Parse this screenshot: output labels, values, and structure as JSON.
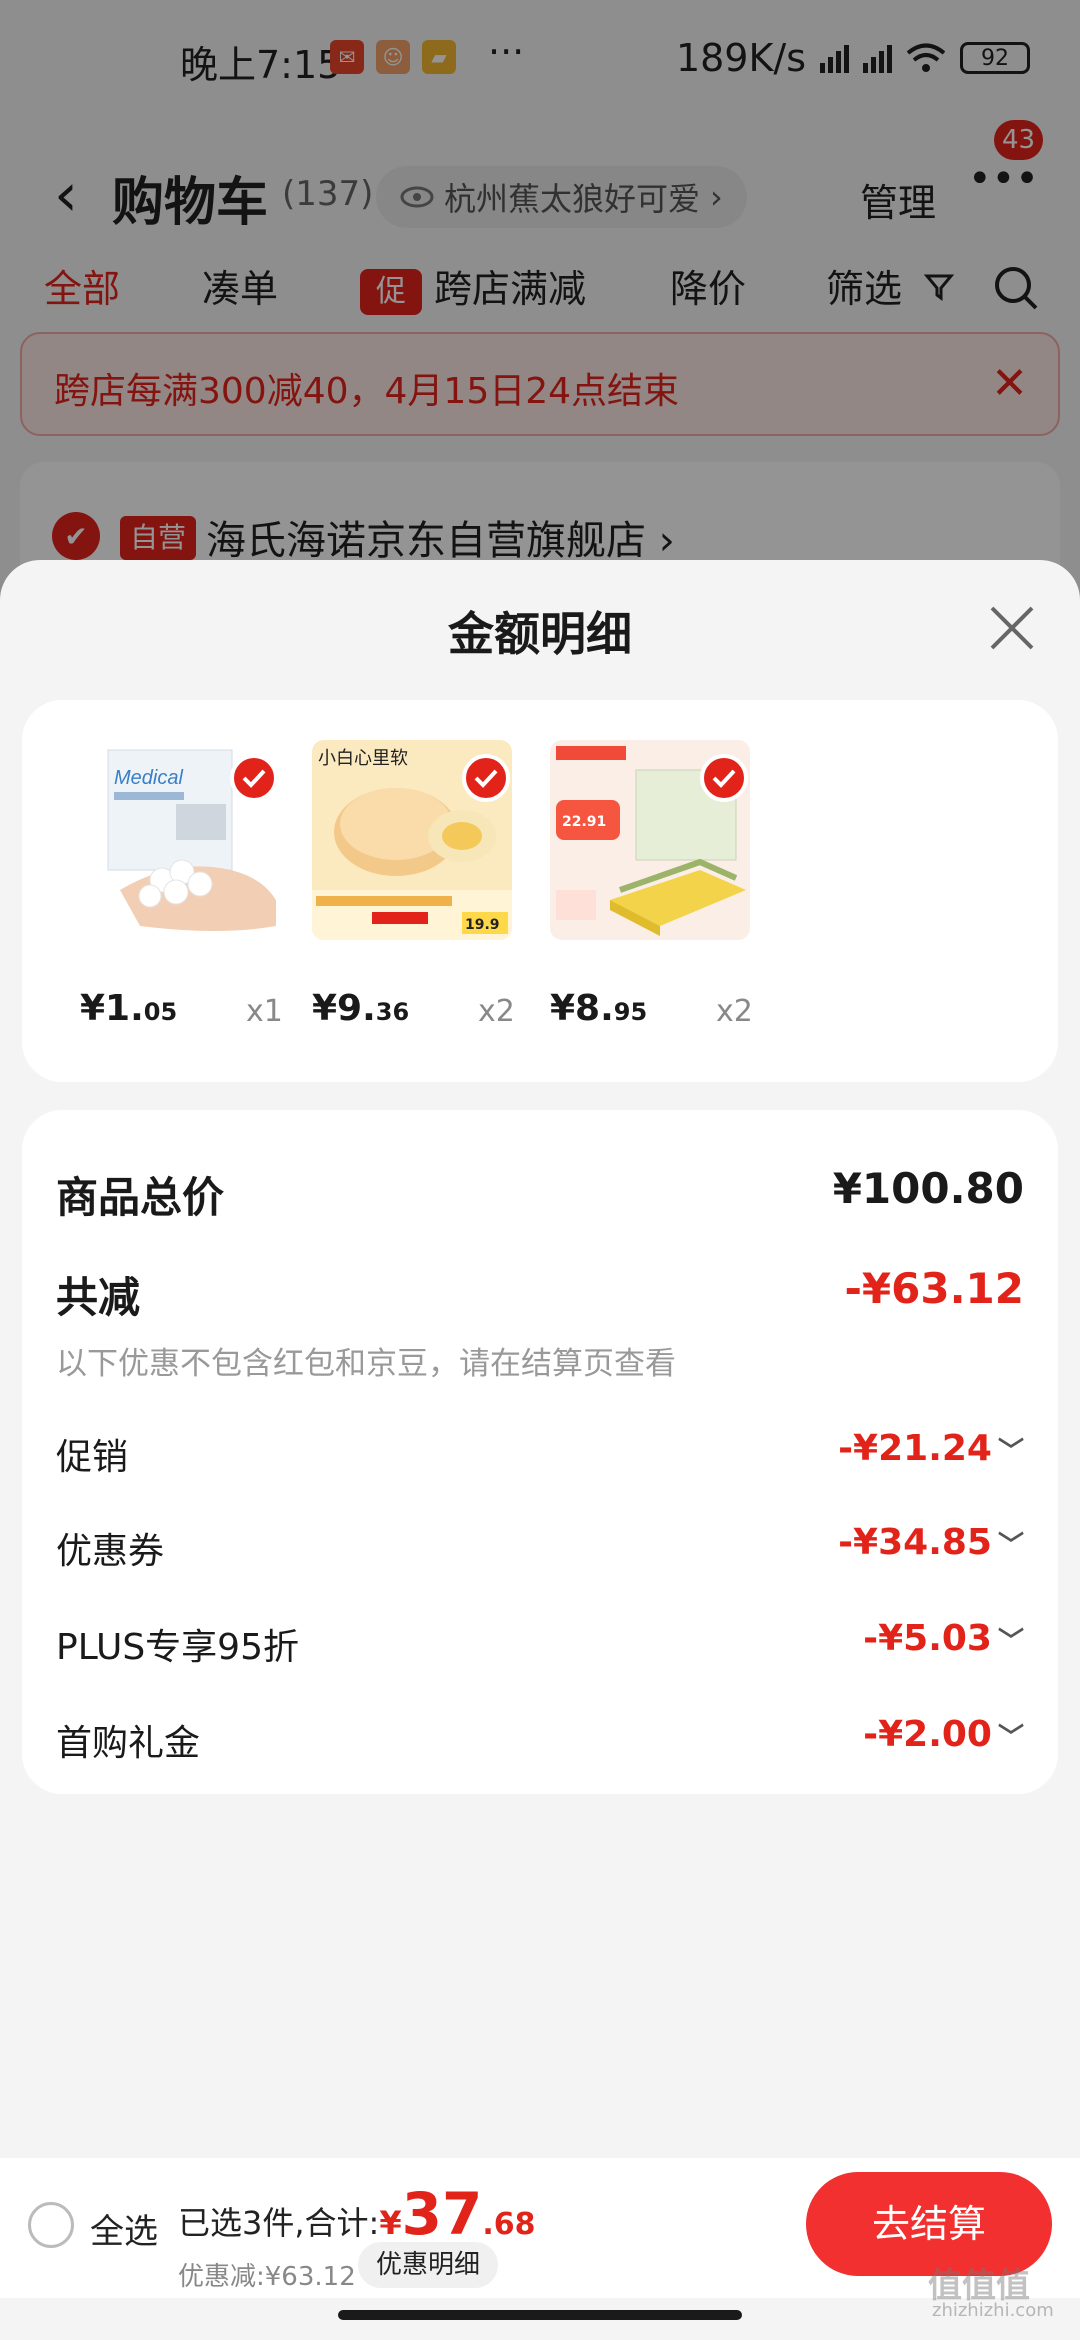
{
  "status_bar": {
    "time": "晚上7:15",
    "more": "···",
    "net_speed": "189K/s",
    "battery": "92"
  },
  "nav": {
    "title": "购物车",
    "count": "(137)",
    "location": "杭州蕉太狼好可爱",
    "manage": "管理",
    "badge": "43"
  },
  "tabs": {
    "all": "全部",
    "combine": "凑单",
    "promo_tag": "促",
    "cross_store": "跨店满减",
    "price_drop": "降价",
    "filter": "筛选"
  },
  "notice": {
    "text": "跨店每满300减40，4月15日24点结束"
  },
  "shop": {
    "self_tag": "自营",
    "name": "海氏海诺京东自营旗舰店"
  },
  "sheet": {
    "title": "金额明细",
    "products": [
      {
        "price_int": "¥1.",
        "price_dec": "05",
        "qty": "x1",
        "img_text": "Medical"
      },
      {
        "price_int": "¥9.",
        "price_dec": "36",
        "qty": "x2",
        "img_text": "小白心里软",
        "img_price": "19.9"
      },
      {
        "price_int": "¥8.",
        "price_dec": "95",
        "qty": "x2",
        "img_price": "22.91"
      }
    ],
    "summary": {
      "total_label": "商品总价",
      "total_value": "¥100.80",
      "reduce_label": "共减",
      "reduce_value": "-¥63.12",
      "note": "以下优惠不包含红包和京豆，请在结算页查看",
      "rows": [
        {
          "label": "促销",
          "value": "-¥21.24"
        },
        {
          "label": "优惠券",
          "value": "-¥34.85"
        },
        {
          "label": "PLUS专享95折",
          "value": "-¥5.03"
        },
        {
          "label": "首购礼金",
          "value": "-¥2.00"
        }
      ]
    }
  },
  "bottom": {
    "select_all": "全选",
    "selected_prefix": "已选3件,合计:",
    "currency": "¥",
    "total_int": "37",
    "total_dec": ".68",
    "discount": "优惠减:¥63.12",
    "detail_chip": "优惠明细",
    "checkout": "去结算"
  },
  "watermark": {
    "main": "值值值",
    "sub": "zhizhizhi.com"
  },
  "colors": {
    "accent": "#e2231a",
    "checkout": "#f23030"
  }
}
